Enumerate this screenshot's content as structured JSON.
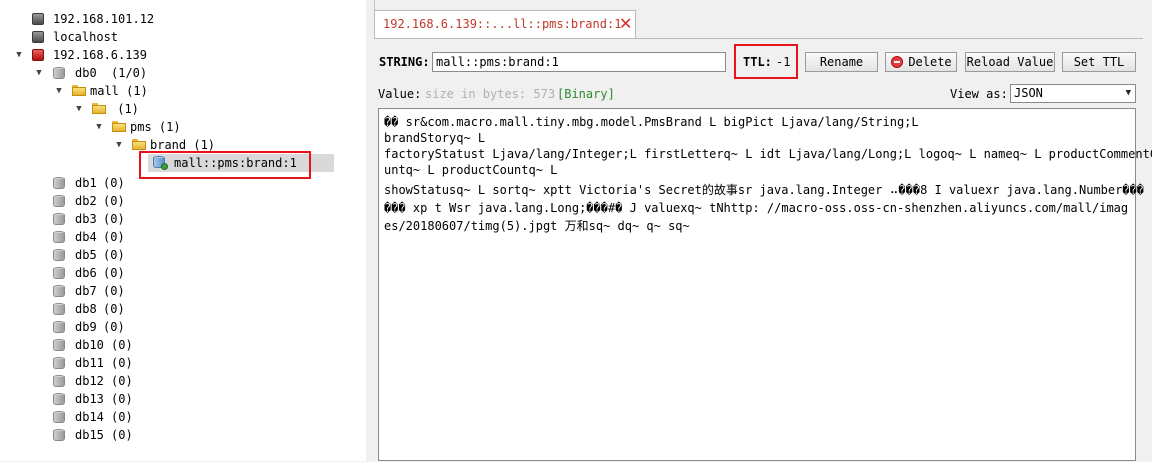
{
  "tree": {
    "servers": [
      {
        "label": "192.168.101.12",
        "icon": "server-icon"
      },
      {
        "label": "localhost",
        "icon": "server-icon"
      },
      {
        "label": "192.168.6.139",
        "icon": "server-icon-red"
      }
    ],
    "db0": {
      "label": "db0",
      "count": "(1/0)"
    },
    "nodes": [
      {
        "label": "mall (1)"
      },
      {
        "label": " (1)"
      },
      {
        "label": "pms (1)"
      },
      {
        "label": "brand (1)"
      }
    ],
    "selected_key": "mall::pms:brand:1",
    "dbs": [
      {
        "label": "db1",
        "count": "(0)"
      },
      {
        "label": "db2",
        "count": "(0)"
      },
      {
        "label": "db3",
        "count": "(0)"
      },
      {
        "label": "db4",
        "count": "(0)"
      },
      {
        "label": "db5",
        "count": "(0)"
      },
      {
        "label": "db6",
        "count": "(0)"
      },
      {
        "label": "db7",
        "count": "(0)"
      },
      {
        "label": "db8",
        "count": "(0)"
      },
      {
        "label": "db9",
        "count": "(0)"
      },
      {
        "label": "db10",
        "count": "(0)"
      },
      {
        "label": "db11",
        "count": "(0)"
      },
      {
        "label": "db12",
        "count": "(0)"
      },
      {
        "label": "db13",
        "count": "(0)"
      },
      {
        "label": "db14",
        "count": "(0)"
      },
      {
        "label": "db15",
        "count": "(0)"
      }
    ]
  },
  "tab": {
    "label": "192.168.6.139::...ll::pms:brand:1"
  },
  "key_bar": {
    "type_label": "STRING:",
    "key_value": "mall::pms:brand:1",
    "ttl_label": "TTL:",
    "ttl_value": "-1",
    "rename_label": "Rename",
    "delete_label": "Delete",
    "reload_label": "Reload Value",
    "set_ttl_label": "Set TTL"
  },
  "value_bar": {
    "value_label": "Value:",
    "size_text": "size in bytes: 573",
    "binary_text": "[Binary]",
    "view_as_label": "View as:",
    "view_as_value": "JSON"
  },
  "value_lines": [
    "�� sr&com.macro.mall.tiny.mbg.model.PmsBrand  L bigPict Ljava/lang/String;L",
    "brandStoryq~ L",
    "factoryStatust Ljava/lang/Integer;L firstLetterq~ L idt Ljava/lang/Long;L logoq~ L nameq~ L productCommentCo",
    "untq~ L  productCountq~ L",
    "showStatusq~ L sortq~ xptt Victoria's Secret的故事sr java.lang.Integer ⠤���8  I valuexr java.lang.Number���",
    "  ��� xp t Wsr java.lang.Long;���#�  J valuexq~  tNhttp: //macro-oss.oss-cn-shenzhen.aliyuncs.com/mall/imag",
    "es/20180607/timg(5).jpgt 万和sq~ dq~ q~        sq~"
  ],
  "colors": {
    "highlight": "#e8121b",
    "tab_text": "#c0392b",
    "binary": "#2e8b2e",
    "size_hint": "#b0b0b0"
  }
}
